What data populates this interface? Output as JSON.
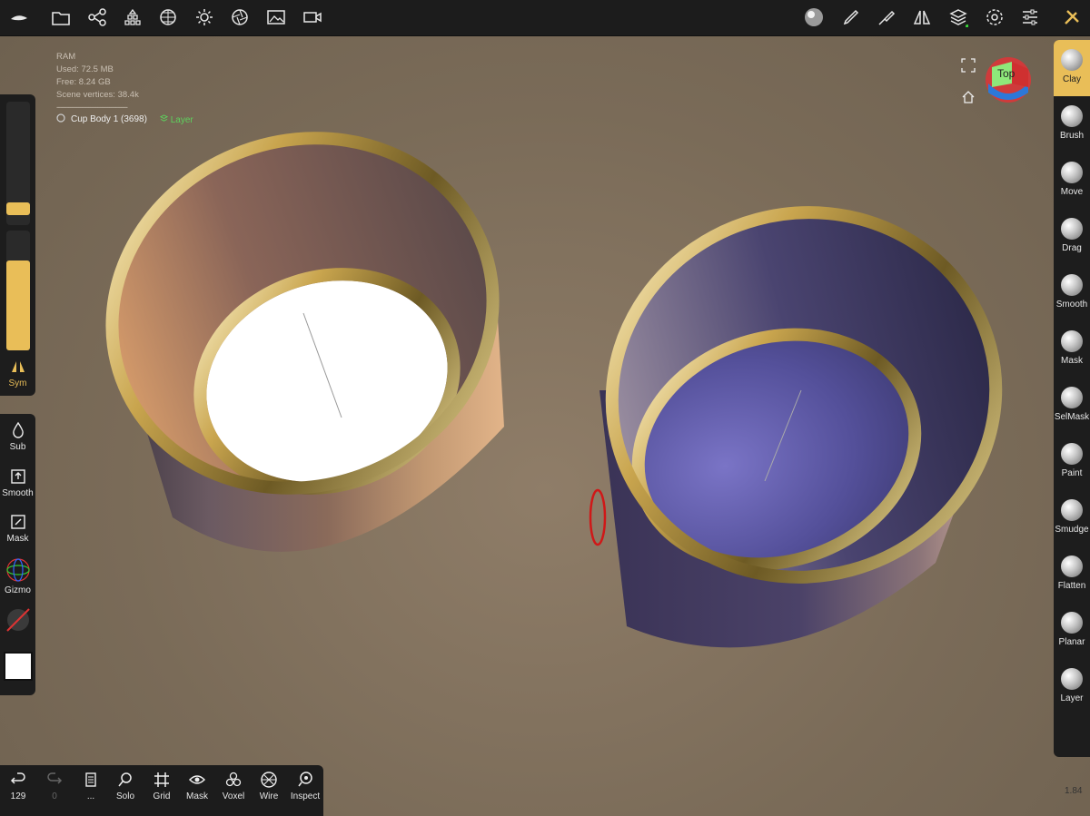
{
  "info": {
    "ram_label": "RAM",
    "used": "Used:  72.5 MB",
    "free": "Free:  8.24 GB",
    "vertices": "Scene vertices:  38.4k",
    "divider": "------------------------------------"
  },
  "object": {
    "name": "Cup Body 1 (3698)",
    "layer": "Layer"
  },
  "view_cube": {
    "label": "Top"
  },
  "left_panel": {
    "sym_label": "Sym",
    "sub_label": "Sub",
    "smooth_label": "Smooth",
    "mask_label": "Mask",
    "gizmo_label": "Gizmo",
    "radius_level": 0.08,
    "intensity_level": 0.75
  },
  "brushes": [
    {
      "label": "Clay"
    },
    {
      "label": "Brush"
    },
    {
      "label": "Move"
    },
    {
      "label": "Drag"
    },
    {
      "label": "Smooth"
    },
    {
      "label": "Mask"
    },
    {
      "label": "SelMask"
    },
    {
      "label": "Paint"
    },
    {
      "label": "Smudge"
    },
    {
      "label": "Flatten"
    },
    {
      "label": "Planar"
    },
    {
      "label": "Layer"
    }
  ],
  "bottom_bar": {
    "undo_count": "129",
    "redo_count": "0",
    "more": "...",
    "solo": "Solo",
    "grid": "Grid",
    "mask": "Mask",
    "voxel": "Voxel",
    "wire": "Wire",
    "inspect": "Inspect"
  },
  "fps": "1.84",
  "colors": {
    "accent": "#e9be58",
    "panel": "#1d1d1d",
    "layer_green": "#5dd25d"
  }
}
